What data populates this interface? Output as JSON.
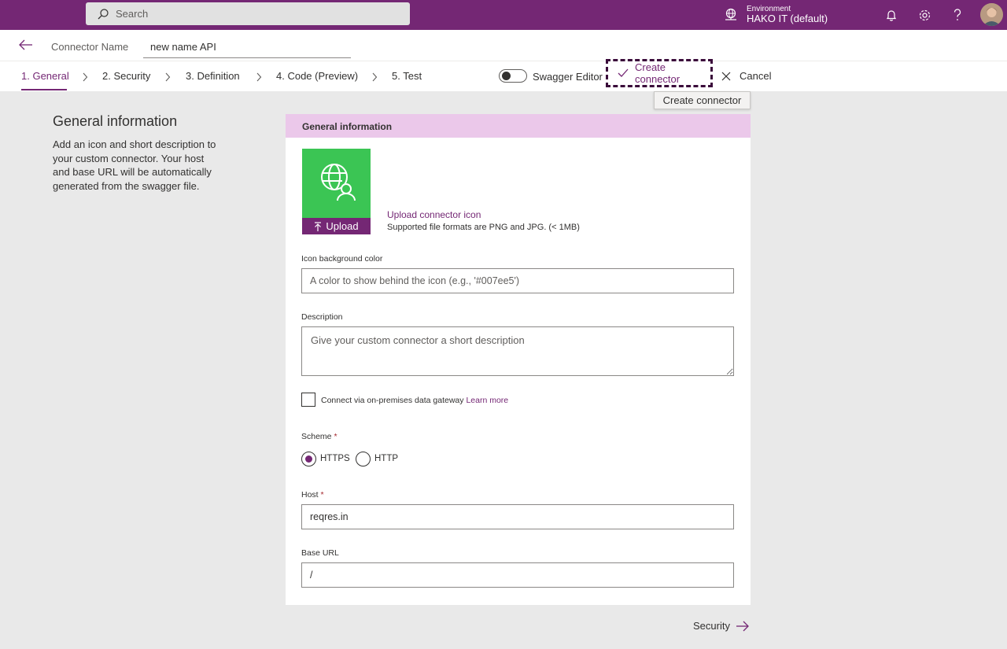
{
  "header": {
    "search_placeholder": "Search",
    "environment_label": "Environment",
    "environment_value": "HAKO IT (default)"
  },
  "connector": {
    "name_label": "Connector Name",
    "name_value": "new name API"
  },
  "tabs": [
    {
      "label": "1. General",
      "active": true
    },
    {
      "label": "2. Security"
    },
    {
      "label": "3. Definition"
    },
    {
      "label": "4. Code (Preview)"
    },
    {
      "label": "5. Test"
    }
  ],
  "toolbar": {
    "swagger_label": "Swagger Editor",
    "create_label": "Create connector",
    "cancel_label": "Cancel",
    "tooltip": "Create connector"
  },
  "side": {
    "title": "General information",
    "description": "Add an icon and short description to your custom connector. Your host and base URL will be automatically generated from the swagger file."
  },
  "card": {
    "header": "General information",
    "upload_label": "Upload",
    "upload_link": "Upload connector icon",
    "upload_note": "Supported file formats are PNG and JPG. (< 1MB)",
    "icon_bg_label": "Icon background color",
    "icon_bg_placeholder": "A color to show behind the icon (e.g., '#007ee5')",
    "description_label": "Description",
    "description_placeholder": "Give your custom connector a short description",
    "gateway_label": "Connect via on-premises data gateway",
    "learn_more": "Learn more",
    "scheme_label": "Scheme",
    "scheme_options": [
      "HTTPS",
      "HTTP"
    ],
    "scheme_selected": "HTTPS",
    "host_label": "Host",
    "host_value": "reqres.in",
    "base_url_label": "Base URL",
    "base_url_value": "/",
    "required_mark": "*"
  },
  "footer": {
    "next_label": "Security"
  },
  "colors": {
    "brand": "#742774",
    "card_header": "#ebc8ea",
    "icon_bg": "#3bc554"
  }
}
